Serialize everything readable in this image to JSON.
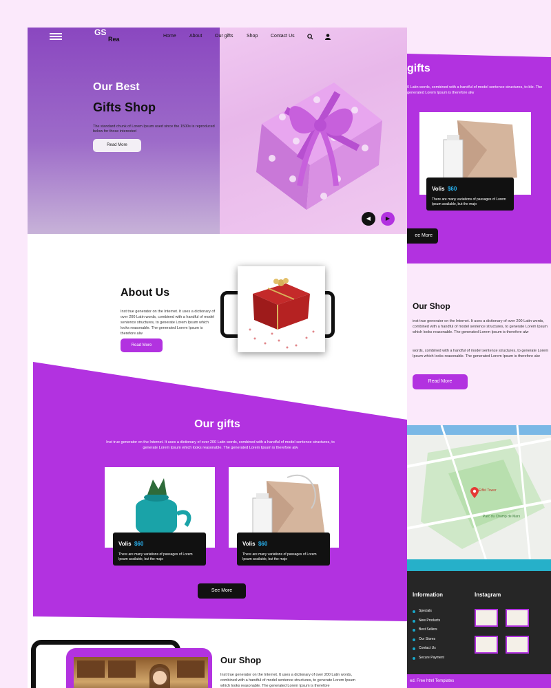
{
  "nav": {
    "logo_letters": "GS",
    "logo_text": "Rea",
    "links": [
      "Home",
      "About",
      "Our gifts",
      "Shop",
      "Contact Us"
    ],
    "icons": [
      "search-icon",
      "user-icon",
      "menu-icon"
    ]
  },
  "hero": {
    "title_line1": "Our Best",
    "title_line2": "Gifts Shop",
    "text": "The standard chunk of Lorem Ipsum used since the 1500s is reproduced below for those interested",
    "button": "Read More",
    "prev_arrow": "◀",
    "next_arrow": "▶"
  },
  "about": {
    "title": "About Us",
    "text": "Inst true generator on the Internet. It uses a dictionary of over 200 Latin words, combined with a handful of model sentence structures, to generate Lorem Ipsum which looks reasonable. The generated Lorem Ipsum is therefore alw",
    "button": "Read More"
  },
  "gifts": {
    "title": "Our gifts",
    "text": "Inst true generator on the Internet. It uses a dictionary of over 200 Latin words, combined with a handful of model sentence structures, to generate Lorem Ipsum which looks reasonable. The generated Lorem Ipsum is therefore alw",
    "items": [
      {
        "name": "Volis",
        "price": "$60",
        "desc": "There are many variations of passages of Lorem Ipsum available, but the majo"
      },
      {
        "name": "Volis",
        "price": "$60",
        "desc": "There are many variations of passages of Lorem Ipsum available, but the majo"
      }
    ],
    "button": "See More"
  },
  "shop": {
    "title": "Our Shop",
    "text": "Inst true generator on the Internet. It uses a dictionary of over 200 Latin words, combined with a handful of model sentence structures, to generate Lorem Ipsum which looks reasonable. The generated Lorem Ipsum is therefore"
  },
  "right": {
    "gifts_title_fragment": "gifts",
    "gifts_text": "0 Latin words, combined with a handful of model sentence structures, to ble. The generated Lorem Ipsum is therefore alw",
    "card": {
      "name": "Volis",
      "price": "$60",
      "desc": "There are many variations of passages of Lorem Ipsum available, but the majo"
    },
    "see_more_fragment": "ee More",
    "shop_title": "Our Shop",
    "shop_text1": "inst true generator on the Internet. It uses a dictionary of over 200 Latin words, combined with a handful of model sentence structures, to generate Lorem Ipsum which looks reasonable. The generated Lorem Ipsum is therefore alw",
    "shop_text2": "words, combined with a handful of model sentence structures, to generate Lorem Ipsum which looks reasonable. The generated Lorem Ipsum is therefore alw",
    "shop_button": "Read More",
    "map_labels": [
      "Eiffel Tower",
      "Parc du Champ de Mars"
    ],
    "footer": {
      "info_title": "Information",
      "info_links": [
        "Specials",
        "New Products",
        "Best Sellers",
        "Our Stores",
        "Contact Us",
        "Secure Payment"
      ],
      "instagram_title": "Instagram",
      "copyright_fragment": "ed. Free html Templates"
    }
  },
  "colors": {
    "accent": "#b232e0",
    "dark": "#111111",
    "price": "#29b6f6",
    "footer": "#262626"
  }
}
